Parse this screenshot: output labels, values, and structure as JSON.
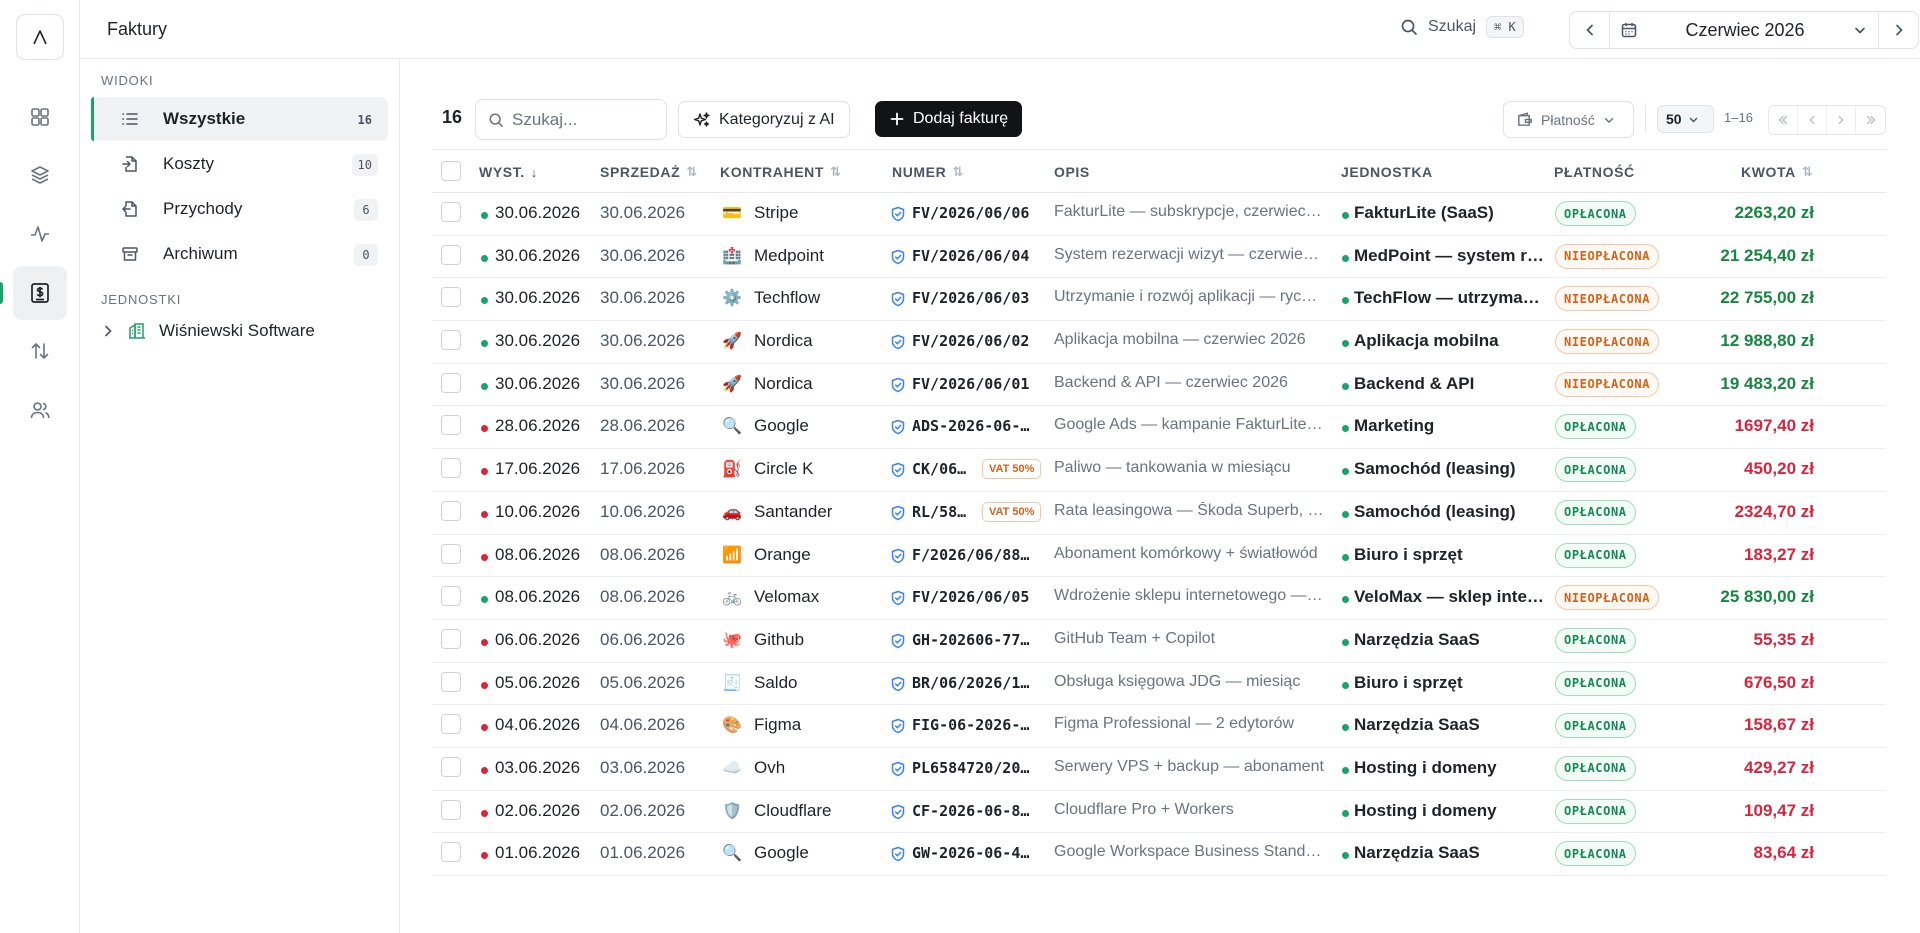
{
  "app": {
    "page_title": "Faktury"
  },
  "topbar": {
    "search_label": "Szukaj",
    "search_shortcut": "⌘ K",
    "period_label": "Czerwiec 2026"
  },
  "sidebar": {
    "views_title": "WIDOKI",
    "views": [
      {
        "label": "Wszystkie",
        "count": "16",
        "icon": "list-icon"
      },
      {
        "label": "Koszty",
        "count": "10",
        "icon": "file-in-icon"
      },
      {
        "label": "Przychody",
        "count": "6",
        "icon": "file-out-icon"
      },
      {
        "label": "Archiwum",
        "count": "0",
        "icon": "archive-icon"
      }
    ],
    "units_title": "JEDNOSTKI",
    "units": [
      {
        "label": "Wiśniewski Software",
        "icon": "building-icon"
      }
    ]
  },
  "toolbar": {
    "total": "16",
    "search_placeholder": "Szukaj...",
    "ai_button": "Kategoryzuj z AI",
    "add_button": "Dodaj fakturę",
    "payment_filter": "Płatność",
    "page_size": "50",
    "range": "1–16"
  },
  "table": {
    "headers": {
      "issued": "WYST.",
      "sale": "SPRZEDAŻ",
      "contractor": "KONTRAHENT",
      "number": "NUMER",
      "description": "OPIS",
      "unit": "JEDNOSTKA",
      "payment": "PŁATNOŚĆ",
      "amount": "KWOTA"
    },
    "rows": [
      {
        "type": "income",
        "issued": "30.06.2026",
        "sale": "30.06.2026",
        "emoji": "💳",
        "contractor": "Stripe",
        "number": "FV/2026/06/06",
        "vat": "",
        "description": "FakturLite — subskrypcje, czerwiec …",
        "unit": "FakturLite (SaaS)",
        "payment": "OPŁACONA",
        "paid": true,
        "amount": "2263,20 zł"
      },
      {
        "type": "income",
        "issued": "30.06.2026",
        "sale": "30.06.2026",
        "emoji": "🏥",
        "contractor": "Medpoint",
        "number": "FV/2026/06/04",
        "vat": "",
        "description": "System rezerwacji wizyt — czerwiec…",
        "unit": "MedPoint — system r…",
        "payment": "NIEOPŁACONA",
        "paid": false,
        "amount": "21 254,40 zł"
      },
      {
        "type": "income",
        "issued": "30.06.2026",
        "sale": "30.06.2026",
        "emoji": "⚙️",
        "contractor": "Techflow",
        "number": "FV/2026/06/03",
        "vat": "",
        "description": "Utrzymanie i rozwój aplikacji — rycz…",
        "unit": "TechFlow — utrzyma…",
        "payment": "NIEOPŁACONA",
        "paid": false,
        "amount": "22 755,00 zł"
      },
      {
        "type": "income",
        "issued": "30.06.2026",
        "sale": "30.06.2026",
        "emoji": "🚀",
        "contractor": "Nordica",
        "number": "FV/2026/06/02",
        "vat": "",
        "description": "Aplikacja mobilna — czerwiec 2026",
        "unit": "Aplikacja mobilna",
        "payment": "NIEOPŁACONA",
        "paid": false,
        "amount": "12 988,80 zł"
      },
      {
        "type": "income",
        "issued": "30.06.2026",
        "sale": "30.06.2026",
        "emoji": "🚀",
        "contractor": "Nordica",
        "number": "FV/2026/06/01",
        "vat": "",
        "description": "Backend & API — czerwiec 2026",
        "unit": "Backend & API",
        "payment": "NIEOPŁACONA",
        "paid": false,
        "amount": "19 483,20 zł"
      },
      {
        "type": "cost",
        "issued": "28.06.2026",
        "sale": "28.06.2026",
        "emoji": "🔍",
        "contractor": "Google",
        "number": "ADS-2026-06-…",
        "vat": "",
        "description": "Google Ads — kampanie FakturLite i…",
        "unit": "Marketing",
        "payment": "OPŁACONA",
        "paid": true,
        "amount": "1697,40 zł"
      },
      {
        "type": "cost",
        "issued": "17.06.2026",
        "sale": "17.06.2026",
        "emoji": "⛽",
        "contractor": "Circle K",
        "number": "CK/06…",
        "vat": "VAT 50%",
        "description": "Paliwo — tankowania w miesiącu",
        "unit": "Samochód (leasing)",
        "payment": "OPŁACONA",
        "paid": true,
        "amount": "450,20 zł"
      },
      {
        "type": "cost",
        "issued": "10.06.2026",
        "sale": "10.06.2026",
        "emoji": "🚗",
        "contractor": "Santander",
        "number": "RL/58…",
        "vat": "VAT 50%",
        "description": "Rata leasingowa — Škoda Superb, u…",
        "unit": "Samochód (leasing)",
        "payment": "OPŁACONA",
        "paid": true,
        "amount": "2324,70 zł"
      },
      {
        "type": "cost",
        "issued": "08.06.2026",
        "sale": "08.06.2026",
        "emoji": "📶",
        "contractor": "Orange",
        "number": "F/2026/06/88…",
        "vat": "",
        "description": "Abonament komórkowy + światłowód",
        "unit": "Biuro i sprzęt",
        "payment": "OPŁACONA",
        "paid": true,
        "amount": "183,27 zł"
      },
      {
        "type": "income",
        "issued": "08.06.2026",
        "sale": "08.06.2026",
        "emoji": "🚲",
        "contractor": "Velomax",
        "number": "FV/2026/06/05",
        "vat": "",
        "description": "Wdrożenie sklepu internetowego —…",
        "unit": "VeloMax — sklep inte…",
        "payment": "NIEOPŁACONA",
        "paid": false,
        "amount": "25 830,00 zł"
      },
      {
        "type": "cost",
        "issued": "06.06.2026",
        "sale": "06.06.2026",
        "emoji": "🐙",
        "contractor": "Github",
        "number": "GH-202606-77…",
        "vat": "",
        "description": "GitHub Team + Copilot",
        "unit": "Narzędzia SaaS",
        "payment": "OPŁACONA",
        "paid": true,
        "amount": "55,35 zł"
      },
      {
        "type": "cost",
        "issued": "05.06.2026",
        "sale": "05.06.2026",
        "emoji": "🧾",
        "contractor": "Saldo",
        "number": "BR/06/2026/1…",
        "vat": "",
        "description": "Obsługa księgowa JDG — miesiąc",
        "unit": "Biuro i sprzęt",
        "payment": "OPŁACONA",
        "paid": true,
        "amount": "676,50 zł"
      },
      {
        "type": "cost",
        "issued": "04.06.2026",
        "sale": "04.06.2026",
        "emoji": "🎨",
        "contractor": "Figma",
        "number": "FIG-06-2026-…",
        "vat": "",
        "description": "Figma Professional — 2 edytorów",
        "unit": "Narzędzia SaaS",
        "payment": "OPŁACONA",
        "paid": true,
        "amount": "158,67 zł"
      },
      {
        "type": "cost",
        "issued": "03.06.2026",
        "sale": "03.06.2026",
        "emoji": "☁️",
        "contractor": "Ovh",
        "number": "PL6584720/20…",
        "vat": "",
        "description": "Serwery VPS + backup — abonament",
        "unit": "Hosting i domeny",
        "payment": "OPŁACONA",
        "paid": true,
        "amount": "429,27 zł"
      },
      {
        "type": "cost",
        "issued": "02.06.2026",
        "sale": "02.06.2026",
        "emoji": "🛡️",
        "contractor": "Cloudflare",
        "number": "CF-2026-06-8…",
        "vat": "",
        "description": "Cloudflare Pro + Workers",
        "unit": "Hosting i domeny",
        "payment": "OPŁACONA",
        "paid": true,
        "amount": "109,47 zł"
      },
      {
        "type": "cost",
        "issued": "01.06.2026",
        "sale": "01.06.2026",
        "emoji": "🔍",
        "contractor": "Google",
        "number": "GW-2026-06-4…",
        "vat": "",
        "description": "Google Workspace Business Stand…",
        "unit": "Narzędzia SaaS",
        "payment": "OPŁACONA",
        "paid": true,
        "amount": "83,64 zł"
      }
    ]
  },
  "colors": {
    "income": "#16873f",
    "cost": "#d9243e",
    "accent": "#1aa36a"
  }
}
